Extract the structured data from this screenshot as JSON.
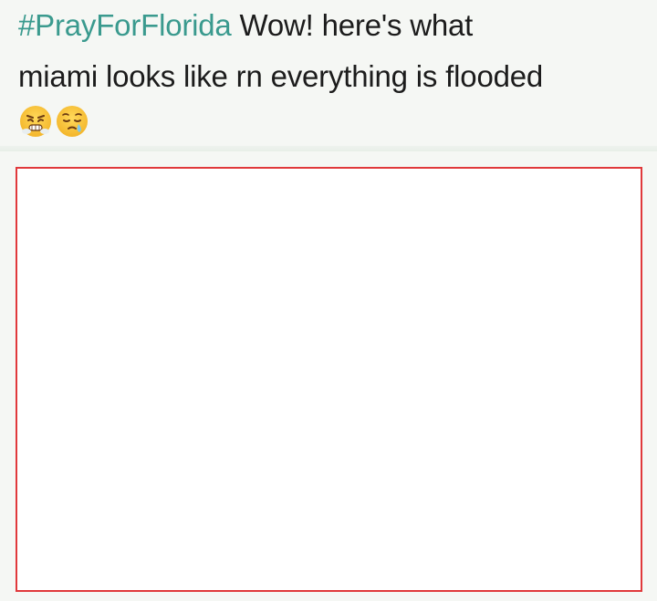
{
  "post": {
    "hashtag": "#PrayForFlorida",
    "line1_rest": " Wow! here's what",
    "line2": "miami looks like rn everything is flooded",
    "emojis": [
      "face-with-steam-from-nose-emoji",
      "sleepy-face-emoji"
    ]
  },
  "colors": {
    "hashtag": "#3a9a8e",
    "text": "#1c1c1c",
    "frame_border": "#e0393b",
    "frame_fill": "#ffffff",
    "background": "#f5f7f4"
  }
}
